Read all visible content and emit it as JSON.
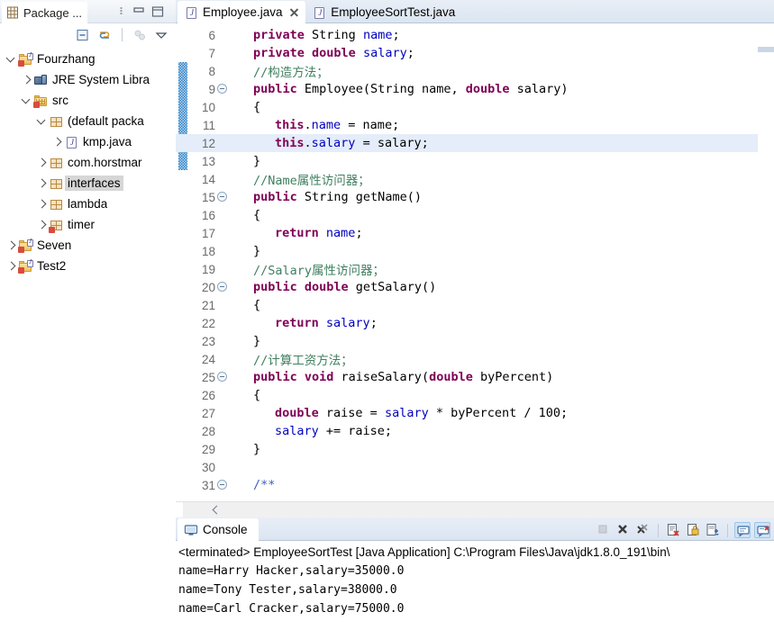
{
  "explorer": {
    "title": "Package ...",
    "icon": "package-explorer-icon",
    "minimize_icon": "minimize-icon",
    "maximize_icon": "maximize-icon",
    "toolbar": [
      {
        "name": "collapse-all-icon",
        "label": "Collapse All"
      },
      {
        "name": "link-with-editor-icon",
        "label": "Link with Editor"
      },
      {
        "name": "focus-on-active-task-icon",
        "label": "Focus on Active Task"
      },
      {
        "name": "view-menu-icon",
        "label": "View Menu"
      }
    ],
    "tree": [
      {
        "label": "Fourzhang",
        "icon": "java-project-icon",
        "indent": 0,
        "twisty": "open",
        "selected": false
      },
      {
        "label": "JRE System Libra",
        "icon": "jre-library-icon",
        "indent": 1,
        "twisty": "closed",
        "selected": false
      },
      {
        "label": "src",
        "icon": "source-folder-icon",
        "indent": 1,
        "twisty": "open",
        "selected": false
      },
      {
        "label": "(default packa",
        "icon": "package-icon",
        "indent": 2,
        "twisty": "open",
        "selected": false
      },
      {
        "label": "kmp.java",
        "icon": "java-file-icon",
        "indent": 3,
        "twisty": "closed",
        "selected": false
      },
      {
        "label": "com.horstmar",
        "icon": "package-icon",
        "indent": 2,
        "twisty": "closed",
        "selected": false
      },
      {
        "label": "interfaces",
        "icon": "package-icon",
        "indent": 2,
        "twisty": "closed",
        "selected": true
      },
      {
        "label": "lambda",
        "icon": "package-icon",
        "indent": 2,
        "twisty": "closed",
        "selected": false
      },
      {
        "label": "timer",
        "icon": "package-error-icon",
        "indent": 2,
        "twisty": "closed",
        "selected": false
      },
      {
        "label": "Seven",
        "icon": "java-project-icon",
        "indent": 0,
        "twisty": "closed",
        "selected": false
      },
      {
        "label": "Test2",
        "icon": "java-project-icon",
        "indent": 0,
        "twisty": "closed",
        "selected": false
      }
    ]
  },
  "editor": {
    "tabs": [
      {
        "label": "Employee.java",
        "icon": "java-file-icon",
        "active": true,
        "closable": true
      },
      {
        "label": "EmployeeSortTest.java",
        "icon": "java-file-icon",
        "active": false,
        "closable": false
      }
    ],
    "highlighted_line": 12,
    "change_bar_lines": [
      8,
      13
    ],
    "lines": [
      {
        "n": 6,
        "fold": false,
        "tokens": [
          {
            "t": "kw",
            "v": "private"
          },
          {
            "t": "plain",
            "v": " String "
          },
          {
            "t": "fld",
            "v": "name"
          },
          {
            "t": "plain",
            "v": ";"
          }
        ],
        "indent": 1
      },
      {
        "n": 7,
        "fold": false,
        "tokens": [
          {
            "t": "kw",
            "v": "private double"
          },
          {
            "t": "plain",
            "v": " "
          },
          {
            "t": "fld",
            "v": "salary"
          },
          {
            "t": "plain",
            "v": ";"
          }
        ],
        "indent": 1
      },
      {
        "n": 8,
        "fold": false,
        "tokens": [
          {
            "t": "cmt",
            "v": "//构造方法；"
          }
        ],
        "indent": 1
      },
      {
        "n": 9,
        "fold": true,
        "tokens": [
          {
            "t": "kw",
            "v": "public"
          },
          {
            "t": "plain",
            "v": " Employee(String name, "
          },
          {
            "t": "kw",
            "v": "double"
          },
          {
            "t": "plain",
            "v": " salary)"
          }
        ],
        "indent": 1
      },
      {
        "n": 10,
        "fold": false,
        "tokens": [
          {
            "t": "plain",
            "v": "{"
          }
        ],
        "indent": 1
      },
      {
        "n": 11,
        "fold": false,
        "tokens": [
          {
            "t": "kw",
            "v": "this"
          },
          {
            "t": "plain",
            "v": "."
          },
          {
            "t": "fld",
            "v": "name"
          },
          {
            "t": "plain",
            "v": " = name;"
          }
        ],
        "indent": 2
      },
      {
        "n": 12,
        "fold": false,
        "tokens": [
          {
            "t": "kw",
            "v": "this"
          },
          {
            "t": "plain",
            "v": "."
          },
          {
            "t": "fld",
            "v": "salary"
          },
          {
            "t": "plain",
            "v": " = salary;"
          }
        ],
        "indent": 2
      },
      {
        "n": 13,
        "fold": false,
        "tokens": [
          {
            "t": "plain",
            "v": "}"
          }
        ],
        "indent": 1
      },
      {
        "n": 14,
        "fold": false,
        "tokens": [
          {
            "t": "cmt",
            "v": "//Name属性访问器；"
          }
        ],
        "indent": 1
      },
      {
        "n": 15,
        "fold": true,
        "tokens": [
          {
            "t": "kw",
            "v": "public"
          },
          {
            "t": "plain",
            "v": " String getName()"
          }
        ],
        "indent": 1
      },
      {
        "n": 16,
        "fold": false,
        "tokens": [
          {
            "t": "plain",
            "v": "{"
          }
        ],
        "indent": 1
      },
      {
        "n": 17,
        "fold": false,
        "tokens": [
          {
            "t": "kw",
            "v": "return"
          },
          {
            "t": "plain",
            "v": " "
          },
          {
            "t": "fld",
            "v": "name"
          },
          {
            "t": "plain",
            "v": ";"
          }
        ],
        "indent": 2
      },
      {
        "n": 18,
        "fold": false,
        "tokens": [
          {
            "t": "plain",
            "v": "}"
          }
        ],
        "indent": 1
      },
      {
        "n": 19,
        "fold": false,
        "tokens": [
          {
            "t": "cmt",
            "v": "//Salary属性访问器；"
          }
        ],
        "indent": 1
      },
      {
        "n": 20,
        "fold": true,
        "tokens": [
          {
            "t": "kw",
            "v": "public double"
          },
          {
            "t": "plain",
            "v": " getSalary()"
          }
        ],
        "indent": 1
      },
      {
        "n": 21,
        "fold": false,
        "tokens": [
          {
            "t": "plain",
            "v": "{"
          }
        ],
        "indent": 1
      },
      {
        "n": 22,
        "fold": false,
        "tokens": [
          {
            "t": "kw",
            "v": "return"
          },
          {
            "t": "plain",
            "v": " "
          },
          {
            "t": "fld",
            "v": "salary"
          },
          {
            "t": "plain",
            "v": ";"
          }
        ],
        "indent": 2
      },
      {
        "n": 23,
        "fold": false,
        "tokens": [
          {
            "t": "plain",
            "v": "}"
          }
        ],
        "indent": 1
      },
      {
        "n": 24,
        "fold": false,
        "tokens": [
          {
            "t": "cmt",
            "v": "//计算工资方法；"
          }
        ],
        "indent": 1
      },
      {
        "n": 25,
        "fold": true,
        "tokens": [
          {
            "t": "kw",
            "v": "public void"
          },
          {
            "t": "plain",
            "v": " raiseSalary("
          },
          {
            "t": "kw",
            "v": "double"
          },
          {
            "t": "plain",
            "v": " byPercent)"
          }
        ],
        "indent": 1
      },
      {
        "n": 26,
        "fold": false,
        "tokens": [
          {
            "t": "plain",
            "v": "{"
          }
        ],
        "indent": 1
      },
      {
        "n": 27,
        "fold": false,
        "tokens": [
          {
            "t": "kw",
            "v": "double"
          },
          {
            "t": "plain",
            "v": " raise = "
          },
          {
            "t": "fld",
            "v": "salary"
          },
          {
            "t": "plain",
            "v": " * byPercent / "
          },
          {
            "t": "num",
            "v": "100"
          },
          {
            "t": "plain",
            "v": ";"
          }
        ],
        "indent": 2
      },
      {
        "n": 28,
        "fold": false,
        "tokens": [
          {
            "t": "fld",
            "v": "salary"
          },
          {
            "t": "plain",
            "v": " += raise;"
          }
        ],
        "indent": 2
      },
      {
        "n": 29,
        "fold": false,
        "tokens": [
          {
            "t": "plain",
            "v": "}"
          }
        ],
        "indent": 1
      },
      {
        "n": 30,
        "fold": false,
        "tokens": [],
        "indent": 1
      },
      {
        "n": 31,
        "fold": true,
        "tokens": [
          {
            "t": "jdoc",
            "v": "/**"
          }
        ],
        "indent": 1
      }
    ],
    "hscroll": {
      "left_arrow_icon": "chevron-left-icon"
    }
  },
  "console": {
    "title": "Console",
    "icon": "console-icon",
    "close_icon": "close-icon",
    "toolbar": [
      {
        "name": "terminate-icon",
        "label": "Terminate",
        "toggled": false
      },
      {
        "name": "remove-launch-icon",
        "label": "Remove Launch",
        "toggled": false
      },
      {
        "name": "remove-all-terminated-icon",
        "label": "Remove All Terminated Launches",
        "toggled": false
      },
      {
        "name": "clear-console-icon",
        "label": "Clear Console",
        "toggled": false
      },
      {
        "name": "scroll-lock-icon",
        "label": "Scroll Lock",
        "toggled": false
      },
      {
        "name": "pin-console-icon",
        "label": "Pin Console",
        "toggled": false
      },
      {
        "name": "display-selected-console-icon",
        "label": "Display Selected Console",
        "toggled": true
      },
      {
        "name": "open-console-icon",
        "label": "Open Console",
        "toggled": true
      }
    ],
    "header": "<terminated> EmployeeSortTest [Java Application] C:\\Program Files\\Java\\jdk1.8.0_191\\bin\\",
    "output": [
      "name=Harry Hacker,salary=35000.0",
      "name=Tony Tester,salary=38000.0",
      "name=Carl Cracker,salary=75000.0"
    ]
  },
  "colors": {
    "keyword": "#7f0055",
    "comment": "#3f7f5f",
    "javadoc": "#3f5fbf",
    "field": "#0000c0",
    "line_highlight": "#e4edf9",
    "tab_active_bg": "#ffffff",
    "tab_bar_bg": "#dbe5f1",
    "selection_bg": "#d6d6d6",
    "change_bar": "#2b7fc4"
  }
}
